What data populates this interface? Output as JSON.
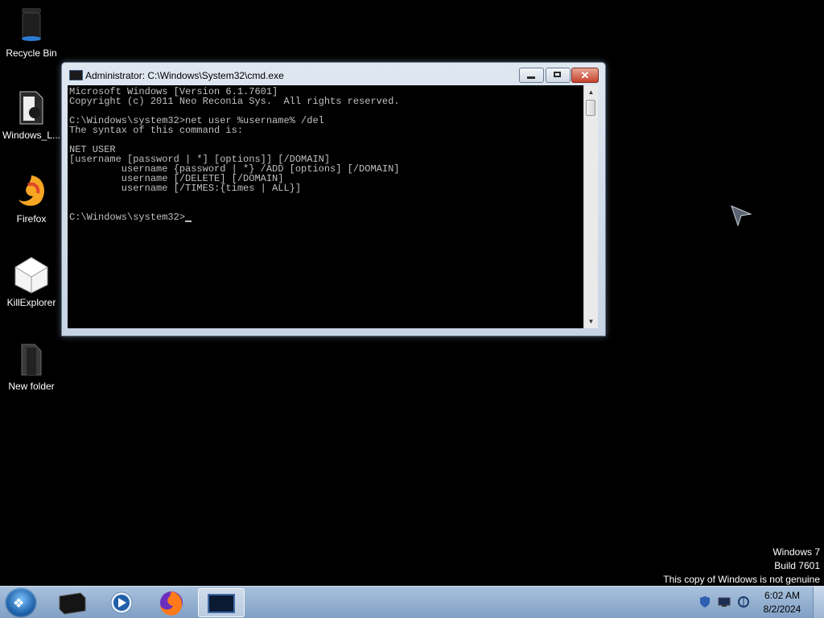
{
  "desktop": {
    "icons": [
      {
        "label": "Recycle Bin",
        "icon": "recycle-bin-icon"
      },
      {
        "label": "Windows_L...",
        "icon": "folder-icon"
      },
      {
        "label": "Firefox",
        "icon": "firefox-icon"
      },
      {
        "label": "KillExplorer",
        "icon": "cube-icon"
      },
      {
        "label": "New folder",
        "icon": "folder-icon"
      }
    ]
  },
  "window": {
    "title": "Administrator: C:\\Windows\\System32\\cmd.exe",
    "close_label": "✕",
    "console_lines": [
      "Microsoft Windows [Version 6.1.7601]",
      "Copyright (c) 2011 Neo Reconia Sys.  All rights reserved.",
      "",
      "C:\\Windows\\system32>net user %username% /del",
      "The syntax of this command is:",
      "",
      "NET USER",
      "[username [password | *] [options]] [/DOMAIN]",
      "         username {password | *} /ADD [options] [/DOMAIN]",
      "         username [/DELETE] [/DOMAIN]",
      "         username [/TIMES:{times | ALL}]",
      "",
      ""
    ],
    "prompt": "C:\\Windows\\system32>"
  },
  "watermark": {
    "line1": "Windows 7",
    "line2": "Build 7601",
    "line3": "This copy of Windows is not genuine"
  },
  "taskbar": {
    "apps": [
      "terminal-app-icon",
      "media-player-icon",
      "firefox-icon",
      "cmd-icon"
    ],
    "tray": [
      "defender-icon",
      "display-icon",
      "network-icon"
    ],
    "time": "6:02 AM",
    "date": "8/2/2024"
  }
}
